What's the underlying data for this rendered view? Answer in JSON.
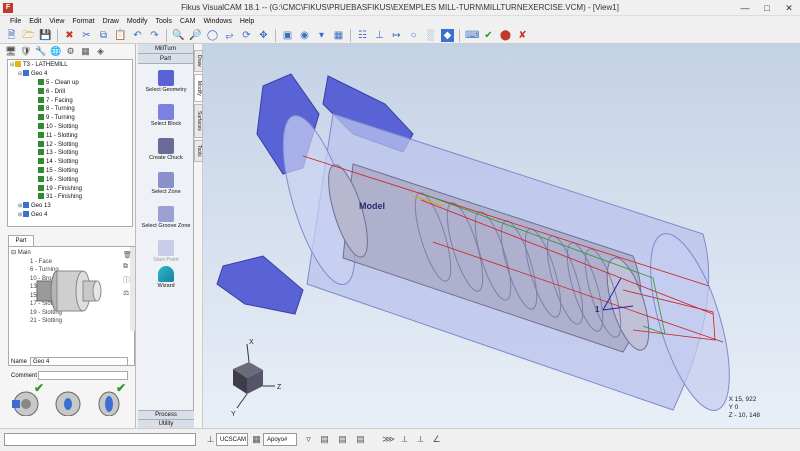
{
  "window": {
    "title": "Fikus VisualCAM 18.1 -- (G:\\CMC\\FIKUS\\PRUEBASFIKUS\\EXEMPLES MILL-TURN\\MILLTURNEXERCISE.VCM) - [View1]"
  },
  "menu": [
    "File",
    "Edit",
    "View",
    "Format",
    "Draw",
    "Modify",
    "Tools",
    "CAM",
    "Windows",
    "Help"
  ],
  "tree": {
    "root": "T3 - LATHEMILL",
    "geo": "Geo 4",
    "ops": [
      "5 - Clean up",
      "6 - Drill",
      "7 - Facing",
      "8 - Turning",
      "9 - Turning",
      "10 - Slotting",
      "11 - Slotting",
      "12 - Slotting",
      "13 - Slotting",
      "14 - Slotting",
      "15 - Slotting",
      "16 - Slotting",
      "19 - Finishing",
      "31 - Finishing"
    ],
    "extra": [
      "Geo 13",
      "Geo 4"
    ]
  },
  "part": {
    "tab": "Part",
    "main": "Main",
    "ops": [
      "1 - Face",
      "6 - Turning",
      "10 - Broach",
      "13 - Slotting",
      "15 - Slotting",
      "17 - Slotting",
      "19 - Slotting",
      "21 - Slotting"
    ],
    "name_label": "Name",
    "name_value": "Geo 4",
    "comment_label": "Comment",
    "comment_value": ""
  },
  "millturn": {
    "header": "MillTurn",
    "sub": "Part",
    "buttons": [
      "Select Geometry",
      "Select Block",
      "Create Chuck",
      "Select Zone",
      "Select Groove Zone",
      "Start Point",
      "Wizard"
    ],
    "footer1": "Process",
    "footer2": "Utility"
  },
  "vtabs": [
    "Draw",
    "Modify",
    "Surfaces",
    "Tools"
  ],
  "viewport": {
    "model_label": "Model",
    "axis_x": "X",
    "axis_y": "Y",
    "axis_z": "Z"
  },
  "coords": {
    "x": "X 15, 922",
    "y": "Y 0",
    "z": "Z - 10, 148"
  },
  "status": {
    "cmd_value": "",
    "ucs": "UCSCAM",
    "support": "Apoyo#"
  },
  "colors": {
    "part_blue": "#5a63d6",
    "stock": "#b9c3ec",
    "toolpath_red": "#cc2222",
    "accent_green": "#2a9a2a"
  }
}
